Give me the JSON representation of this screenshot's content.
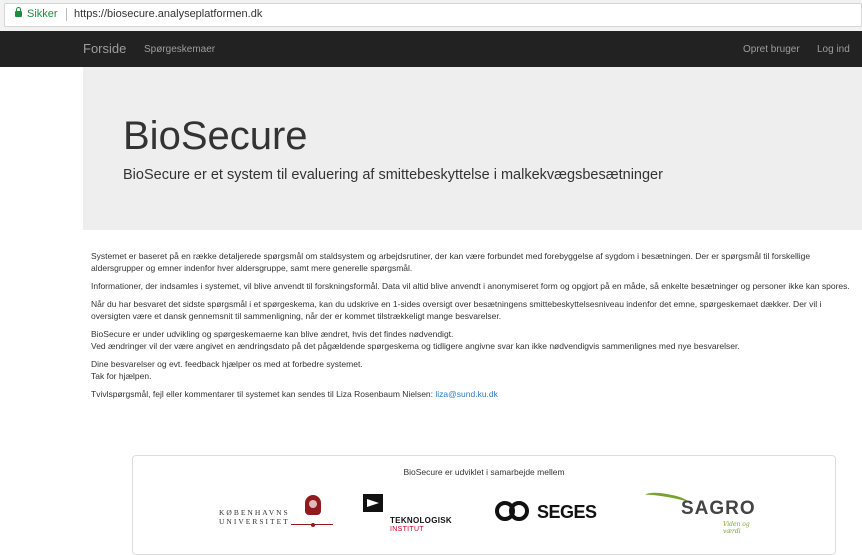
{
  "browser": {
    "secure_label": "Sikker",
    "url": "https://biosecure.analyseplatformen.dk"
  },
  "navbar": {
    "brand": "Forside",
    "links": [
      "Spørgeskemaer"
    ],
    "right_links": [
      "Opret bruger",
      "Log ind"
    ]
  },
  "jumbotron": {
    "title": "BioSecure",
    "subtitle": "BioSecure er et system til evaluering af smittebeskyttelse i malkekvægsbesætninger"
  },
  "content": {
    "paragraphs": [
      "Systemet er baseret på en række detaljerede spørgsmål om staldsystem og arbejdsrutiner, der kan være forbundet med forebyggelse af sygdom i besætningen. Der er spørgsmål til forskellige aldersgrupper og emner indenfor hver aldersgruppe, samt mere generelle spørgsmål.",
      "Informationer, der indsamles i systemet, vil blive anvendt til forskningsformål. Data vil altid blive anvendt i anonymiseret form og opgjort på en måde, så enkelte besætninger og personer ikke kan spores.",
      "Når du har besvaret det sidste spørgsmål i et spørgeskema, kan du udskrive en 1-sides oversigt over besætningens smittebeskyttelsesniveau indenfor det emne, spørgeskemaet dækker. Der vil i oversigten være et dansk gennemsnit til sammenligning, når der er kommet tilstrækkeligt mange besvarelser.",
      "BioSecure er under udvikling og spørgeskemaerne kan blive ændret, hvis det findes nødvendigt.",
      "Ved ændringer vil der være angivet en ændringsdato på det pågældende spørgeskema og tidligere angivne svar kan ikke nødvendigvis sammenlignes med nye besvarelser.",
      "Dine besvarelser og evt. feedback hjælper os med at forbedre systemet.",
      "Tak for hjælpen.",
      "Tvivlspørgsmål, fejl eller kommentarer til systemet kan sendes til Liza Rosenbaum Nielsen:"
    ],
    "contact_email": "liza@sund.ku.dk"
  },
  "partners": {
    "title": "BioSecure er udviklet i samarbejde mellem",
    "ku": [
      "KØBENHAVNS",
      "UNIVERSITET"
    ],
    "ti": [
      "TEKNOLOGISK",
      "INSTITUT"
    ],
    "seges": "SEGES",
    "sagro": "SAGRO",
    "sagro_tagline": "Viden og værdi"
  },
  "colors": {
    "navbar_bg": "#222222",
    "jumbotron_bg": "#eeeeee",
    "link": "#337ab7",
    "secure_green": "#1e8e3e",
    "ku_red": "#901a1e",
    "ti_red": "#d0021b",
    "sagro_green": "#78a22f"
  }
}
